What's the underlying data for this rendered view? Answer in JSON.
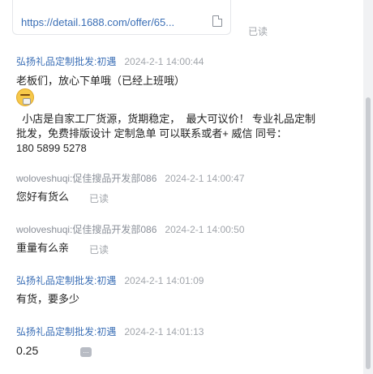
{
  "link_card": {
    "url": "https://detail.1688.com/offer/65..."
  },
  "read_label": "已读",
  "messages": [
    {
      "sender": "弘扬礼品定制批发:初遇",
      "time": "2024-2-1 14:00:44",
      "line1": "老板们，放心下单哦（已经上班哦）",
      "line2": "  小店是自家工厂货源，货期稳定，  最大可议价！ 专业礼品定制",
      "line3": "批发，免费排版设计  定制急单  可以联系或者+ 威信 同号：",
      "line4": "180 5899 5278"
    },
    {
      "sender": "woloveshuqi:促佳搜品开发部086",
      "time": "2024-2-1 14:00:47",
      "text": "您好有货么"
    },
    {
      "sender": "woloveshuqi:促佳搜品开发部086",
      "time": "2024-2-1 14:00:50",
      "text": "重量有么亲"
    },
    {
      "sender": "弘扬礼品定制批发:初遇",
      "time": "2024-2-1 14:01:09",
      "text": "有货，要多少"
    },
    {
      "sender": "弘扬礼品定制批发:初遇",
      "time": "2024-2-1 14:01:13",
      "text": "0.25"
    }
  ]
}
